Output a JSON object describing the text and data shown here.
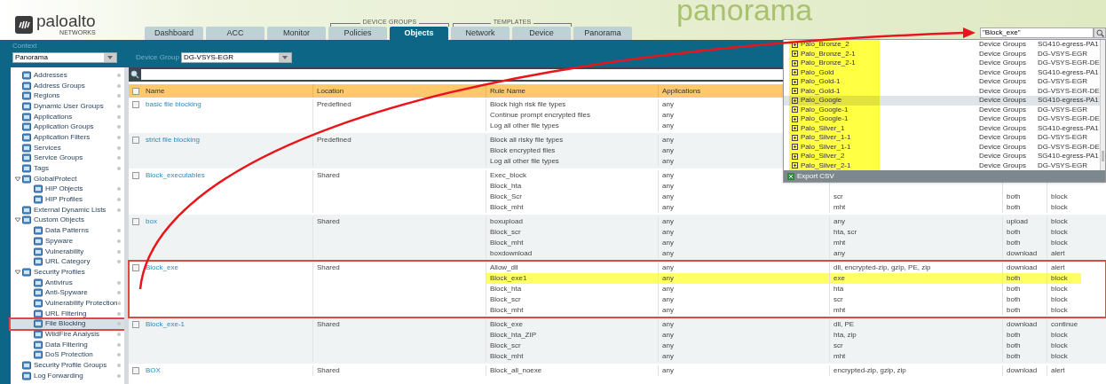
{
  "header": {
    "logo": "paloalto",
    "logo_sub": "NETWORKS",
    "banner": "panorama",
    "tab_sections": [
      {
        "tabs": [
          {
            "label": "Dashboard",
            "selected": false
          },
          {
            "label": "ACC",
            "selected": false
          },
          {
            "label": "Monitor",
            "selected": false
          }
        ]
      },
      {
        "label": "DEVICE GROUPS",
        "tabs": [
          {
            "label": "Policies",
            "selected": false
          },
          {
            "label": "Objects",
            "selected": true
          }
        ]
      },
      {
        "label": "TEMPLATES",
        "tabs": [
          {
            "label": "Network",
            "selected": false
          },
          {
            "label": "Device",
            "selected": false
          }
        ]
      },
      {
        "tabs": [
          {
            "label": "Panorama",
            "selected": false
          }
        ]
      }
    ],
    "search": {
      "value": "\"Block_exe\""
    }
  },
  "context": {
    "label": "Context",
    "value": "Panorama"
  },
  "device_group": {
    "label": "Device Group",
    "value": "DG-VSYS-EGR"
  },
  "sidebar": {
    "items": [
      {
        "label": "Addresses",
        "selected": false
      },
      {
        "label": "Address Groups",
        "selected": false
      },
      {
        "label": "Regions",
        "selected": false
      },
      {
        "label": "Dynamic User Groups",
        "selected": false
      },
      {
        "label": "Applications",
        "selected": false
      },
      {
        "label": "Application Groups",
        "selected": false
      },
      {
        "label": "Application Filters",
        "selected": false
      },
      {
        "label": "Services",
        "selected": false
      },
      {
        "label": "Service Groups",
        "selected": false
      },
      {
        "label": "Tags",
        "selected": false
      },
      {
        "label": "GlobalProtect",
        "selected": false,
        "expanded": true,
        "children": [
          {
            "label": "HIP Objects",
            "selected": false
          },
          {
            "label": "HIP Profiles",
            "selected": false
          }
        ]
      },
      {
        "label": "External Dynamic Lists",
        "selected": false
      },
      {
        "label": "Custom Objects",
        "selected": false,
        "expanded": true,
        "children": [
          {
            "label": "Data Patterns",
            "selected": false
          },
          {
            "label": "Spyware",
            "selected": false
          },
          {
            "label": "Vulnerability",
            "selected": false
          },
          {
            "label": "URL Category",
            "selected": false
          }
        ]
      },
      {
        "label": "Security Profiles",
        "selected": false,
        "expanded": true,
        "children": [
          {
            "label": "Antivirus",
            "selected": false
          },
          {
            "label": "Anti-Spyware",
            "selected": false
          },
          {
            "label": "Vulnerability Protection",
            "selected": false
          },
          {
            "label": "URL Filtering",
            "selected": false
          },
          {
            "label": "File Blocking",
            "selected": true,
            "framed": true
          },
          {
            "label": "WildFire Analysis",
            "selected": false
          },
          {
            "label": "Data Filtering",
            "selected": false
          },
          {
            "label": "DoS Protection",
            "selected": false
          }
        ]
      },
      {
        "label": "Security Profile Groups",
        "selected": false
      },
      {
        "label": "Log Forwarding",
        "selected": false
      }
    ]
  },
  "table": {
    "header_checked": false,
    "columns": [
      "Name",
      "Location",
      "Rule Name",
      "Applications"
    ],
    "rows": [
      {
        "checked": false,
        "name": "basic file blocking",
        "location": "Predefined",
        "rules": [
          {
            "rule": "Block high risk file types",
            "applications": "any"
          },
          {
            "rule": "Continue prompt encrypted files",
            "applications": "any"
          },
          {
            "rule": "Log all other file types",
            "applications": "any"
          }
        ]
      },
      {
        "checked": false,
        "name": "strict file blocking",
        "location": "Predefined",
        "rules": [
          {
            "rule": "Block all risky file types",
            "applications": "any"
          },
          {
            "rule": "Block encrypted files",
            "applications": "any"
          },
          {
            "rule": "Log all other file types",
            "applications": "any"
          }
        ]
      },
      {
        "checked": false,
        "name": "Block_executables",
        "location": "Shared",
        "rules": [
          {
            "rule": "Exec_block",
            "applications": "any"
          },
          {
            "rule": "Block_hta",
            "applications": "any"
          },
          {
            "rule": "Block_Scr",
            "applications": "any",
            "file_types": "scr",
            "direction": "both",
            "action": "block"
          },
          {
            "rule": "Block_mht",
            "applications": "any",
            "file_types": "mht",
            "direction": "both",
            "action": "block"
          }
        ]
      },
      {
        "checked": false,
        "name": "box",
        "location": "Shared",
        "rules": [
          {
            "rule": "boxupload",
            "applications": "any",
            "file_types": "any",
            "direction": "upload",
            "action": "block"
          },
          {
            "rule": "Block_scr",
            "applications": "any",
            "file_types": "hta, scr",
            "direction": "both",
            "action": "block"
          },
          {
            "rule": "Block_mht",
            "applications": "any",
            "file_types": "mht",
            "direction": "both",
            "action": "block"
          },
          {
            "rule": "boxdownload",
            "applications": "any",
            "file_types": "any",
            "direction": "download",
            "action": "alert"
          }
        ]
      },
      {
        "checked": false,
        "framed": true,
        "name": "Block_exe",
        "location": "Shared",
        "rules": [
          {
            "rule": "Allow_dll",
            "applications": "any",
            "file_types": "dll, encrypted-zip, gzip, PE, zip",
            "direction": "download",
            "action": "alert",
            "highlighted": false
          },
          {
            "rule": "Block_exe1",
            "applications": "any",
            "file_types": "exe",
            "direction": "both",
            "action": "block",
            "highlighted": true
          },
          {
            "rule": "Block_hta",
            "applications": "any",
            "file_types": "hta",
            "direction": "both",
            "action": "block",
            "highlighted": false
          },
          {
            "rule": "Block_scr",
            "applications": "any",
            "file_types": "scr",
            "direction": "both",
            "action": "block",
            "highlighted": false
          },
          {
            "rule": "Block_mht",
            "applications": "any",
            "file_types": "mht",
            "direction": "both",
            "action": "block",
            "highlighted": false
          }
        ]
      },
      {
        "checked": false,
        "name": "Block_exe-1",
        "location": "Shared",
        "rules": [
          {
            "rule": "Block_exe",
            "applications": "any",
            "file_types": "dll, PE",
            "direction": "download",
            "action": "continue"
          },
          {
            "rule": "Block_hta_ZIP",
            "applications": "any",
            "file_types": "hta, zip",
            "direction": "both",
            "action": "block"
          },
          {
            "rule": "Block_scr",
            "applications": "any",
            "file_types": "scr",
            "direction": "both",
            "action": "block"
          },
          {
            "rule": "Block_mht",
            "applications": "any",
            "file_types": "mht",
            "direction": "both",
            "action": "block"
          }
        ]
      },
      {
        "checked": false,
        "name": "BOX",
        "location": "Shared",
        "rules": [
          {
            "rule": "Block_all_noexe",
            "applications": "any",
            "file_types": "encrypted-zip, gzip, zip",
            "direction": "download",
            "action": "alert"
          }
        ]
      }
    ]
  },
  "search_results": {
    "export": "Export CSV",
    "items": [
      {
        "name": "Palo_Bronze_2",
        "location": "Device Groups",
        "device_group": "SG410-egress-PA1",
        "selected": false,
        "highlighted": true
      },
      {
        "name": "Palo_Bronze_2-1",
        "location": "Device Groups",
        "device_group": "DG-VSYS-EGR",
        "selected": false,
        "highlighted": true
      },
      {
        "name": "Palo_Bronze_2-1",
        "location": "Device Groups",
        "device_group": "DG-VSYS-EGR-DE",
        "selected": false,
        "highlighted": true
      },
      {
        "name": "Palo_Gold",
        "location": "Device Groups",
        "device_group": "SG410-egress-PA1",
        "selected": false,
        "highlighted": true
      },
      {
        "name": "Palo_Gold-1",
        "location": "Device Groups",
        "device_group": "DG-VSYS-EGR",
        "selected": false,
        "highlighted": true
      },
      {
        "name": "Palo_Gold-1",
        "location": "Device Groups",
        "device_group": "DG-VSYS-EGR-DE",
        "selected": false,
        "highlighted": true
      },
      {
        "name": "Palo_Google",
        "location": "Device Groups",
        "device_group": "SG410-egress-PA1",
        "selected": true,
        "highlighted": true
      },
      {
        "name": "Palo_Google-1",
        "location": "Device Groups",
        "device_group": "DG-VSYS-EGR",
        "selected": false,
        "highlighted": true
      },
      {
        "name": "Palo_Google-1",
        "location": "Device Groups",
        "device_group": "DG-VSYS-EGR-DE",
        "selected": false,
        "highlighted": true
      },
      {
        "name": "Palo_Silver_1",
        "location": "Device Groups",
        "device_group": "SG410-egress-PA1",
        "selected": false,
        "highlighted": true
      },
      {
        "name": "Palo_Silver_1-1",
        "location": "Device Groups",
        "device_group": "DG-VSYS-EGR",
        "selected": false,
        "highlighted": true
      },
      {
        "name": "Palo_Silver_1-1",
        "location": "Device Groups",
        "device_group": "DG-VSYS-EGR-DE",
        "selected": false,
        "highlighted": true
      },
      {
        "name": "Palo_Silver_2",
        "location": "Device Groups",
        "device_group": "SG410-egress-PA1",
        "selected": false,
        "highlighted": true
      },
      {
        "name": "Palo_Silver_2-1",
        "location": "Device Groups",
        "device_group": "DG-VSYS-EGR",
        "selected": false,
        "highlighted": true
      }
    ]
  }
}
